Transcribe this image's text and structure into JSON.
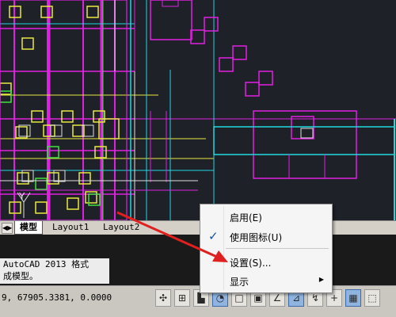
{
  "layout_tabs": {
    "model": "模型",
    "layout1": "Layout1",
    "layout2": "Layout2"
  },
  "command_history": [
    "AutoCAD 2013 格式",
    "成模型。"
  ],
  "status": {
    "coords": "9, 67905.3381, 0.0000",
    "buttons": [
      {
        "icon": "snap-icon",
        "glyph": "✣",
        "on": false
      },
      {
        "icon": "grid-icon",
        "glyph": "⊞",
        "on": false
      },
      {
        "icon": "ortho-icon",
        "glyph": "▙",
        "on": false
      },
      {
        "icon": "polar-icon",
        "glyph": "◔",
        "on": true
      },
      {
        "icon": "osnap-icon",
        "glyph": "□",
        "on": false
      },
      {
        "icon": "3dosnap-icon",
        "glyph": "▣",
        "on": false
      },
      {
        "icon": "otrack-icon",
        "glyph": "∠",
        "on": false
      },
      {
        "icon": "ducs-icon",
        "glyph": "⊿",
        "on": true
      },
      {
        "icon": "dyn-icon",
        "glyph": "↯",
        "on": false
      },
      {
        "icon": "lwt-icon",
        "glyph": "+",
        "on": false
      },
      {
        "icon": "tpy-icon",
        "glyph": "▦",
        "on": true
      },
      {
        "icon": "qp-icon",
        "glyph": "⬚",
        "on": false
      }
    ]
  },
  "context_menu": {
    "start": "启用(E)",
    "use_icons": "使用图标(U)",
    "use_icons_checked": true,
    "settings": "设置(S)...",
    "display": "显示"
  },
  "colors": {
    "background": "#1e2128",
    "magenta": "#e020e0",
    "cyan": "#20d8e0",
    "yellow": "#e8e840",
    "green": "#40e040",
    "white": "#e0e0e0",
    "arrow": "#e02020"
  }
}
